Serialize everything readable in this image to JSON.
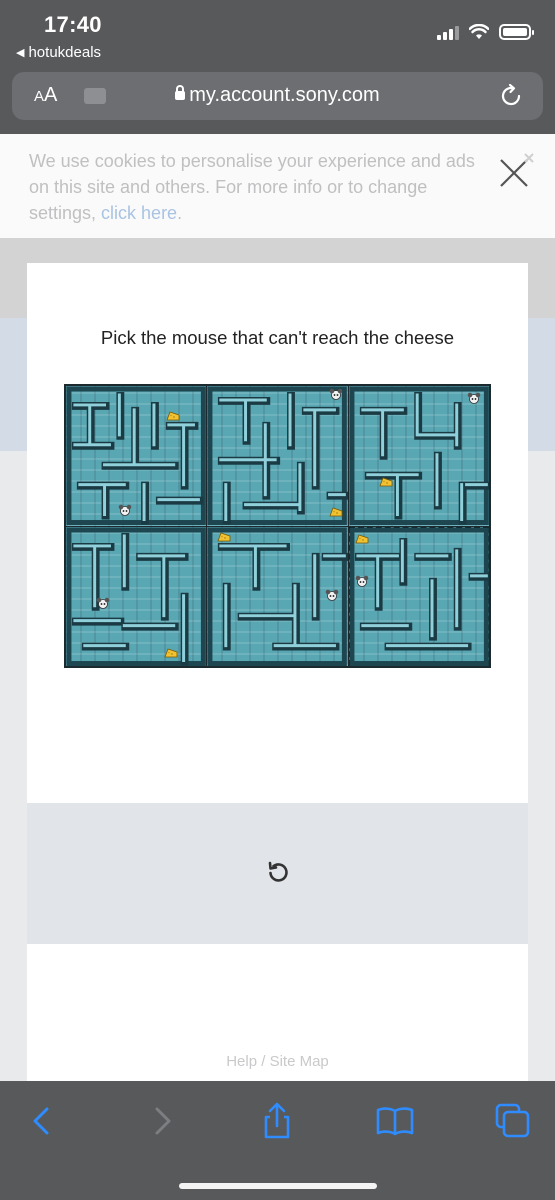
{
  "status_bar": {
    "time": "17:40",
    "back_app": "hotukdeals"
  },
  "browser": {
    "text_size_label_small": "A",
    "text_size_label_large": "A",
    "url": "my.account.sony.com"
  },
  "cookie_banner": {
    "text": "We use cookies to personalise your experience and ads on this site and others. For more info or to change settings, ",
    "link": "click here",
    "suffix": "."
  },
  "captcha": {
    "prompt": "Pick the mouse that can't reach the cheese",
    "tiles": [
      {
        "label": "maze-1",
        "selected": false
      },
      {
        "label": "maze-2",
        "selected": false
      },
      {
        "label": "maze-3",
        "selected": false
      },
      {
        "label": "maze-4",
        "selected": false
      },
      {
        "label": "maze-5",
        "selected": false
      },
      {
        "label": "maze-6",
        "selected": true
      }
    ],
    "refresh_icon": "refresh-icon"
  },
  "footer": {
    "link": "Help / Site Map"
  },
  "colors": {
    "chrome": "#58595b",
    "maze": "#5aa7b4",
    "link": "#a9c3e3"
  }
}
